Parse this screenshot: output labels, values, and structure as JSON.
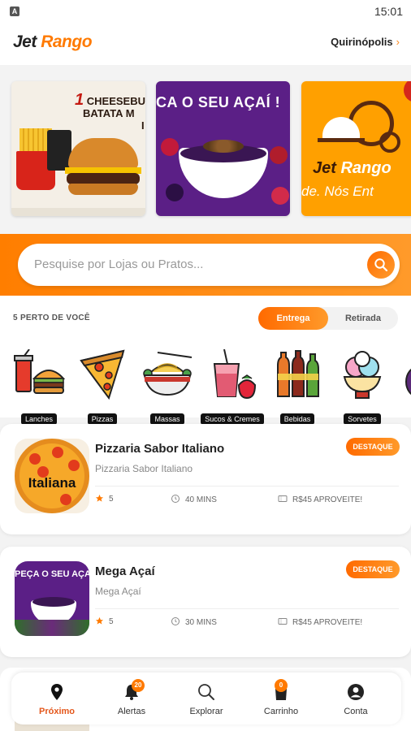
{
  "status_bar": {
    "time": "15:01",
    "notification_icon": "A"
  },
  "header": {
    "logo_word1": "Jet",
    "logo_word2": "Rango",
    "city": "Quirinópolis",
    "city_chevron": "›"
  },
  "banners": [
    {
      "id": "burger",
      "title_line1_prefix": "1",
      "title_line1": "CHEESEBU",
      "title_line2": "BATATA M",
      "title_line3": "I"
    },
    {
      "id": "acai",
      "title": "CA O SEU AÇAÍ !"
    },
    {
      "id": "jetrango",
      "name_a": "Jet",
      "name_b": "Rango",
      "tagline": "de. Nós Ent"
    }
  ],
  "search": {
    "placeholder": "Pesquise por Lojas ou Pratos..."
  },
  "filters": {
    "nearby_label": "5 PERTO DE VOCÊ",
    "delivery_label": "Entrega",
    "pickup_label": "Retirada",
    "selected": "Entrega"
  },
  "categories": [
    {
      "label": "Lanches",
      "icon": "burger-drink-icon"
    },
    {
      "label": "Pizzas",
      "icon": "pizza-slice-icon"
    },
    {
      "label": "Massas",
      "icon": "pasta-bowl-icon"
    },
    {
      "label": "Sucos & Cremes",
      "icon": "juice-icon"
    },
    {
      "label": "Bebidas",
      "icon": "bottles-icon"
    },
    {
      "label": "Sorvetes",
      "icon": "ice-cream-icon"
    }
  ],
  "stores": [
    {
      "name": "Pizzaria Sabor Italiano",
      "subtitle": "Pizzaria Sabor Italiano",
      "badge": "DESTAQUE",
      "rating": "5",
      "time": "40 MINS",
      "promo": "R$45 APROVEITE!",
      "thumb_label": "Italiana"
    },
    {
      "name": "Mega Açaí",
      "subtitle": "Mega Açaí",
      "badge": "DESTAQUE",
      "rating": "5",
      "time": "30 MINS",
      "promo": "R$45 APROVEITE!",
      "thumb_label": "PEÇA O SEU AÇAÍ !"
    }
  ],
  "bottom_nav": [
    {
      "label": "Próximo",
      "icon": "location-pin-icon",
      "active": true
    },
    {
      "label": "Alertas",
      "icon": "bell-icon",
      "badge": "20"
    },
    {
      "label": "Explorar",
      "icon": "search-icon"
    },
    {
      "label": "Carrinho",
      "icon": "bag-icon",
      "badge": "0"
    },
    {
      "label": "Conta",
      "icon": "user-icon"
    }
  ],
  "colors": {
    "accent": "#ff7a00",
    "accent_light": "#ff9a2a",
    "active_nav": "#e4571b",
    "background": "#f3f3f3"
  }
}
